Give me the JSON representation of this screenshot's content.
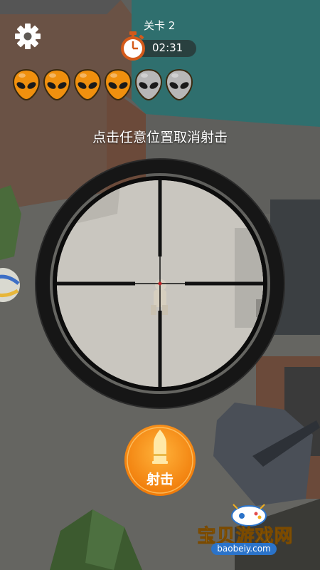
{
  "hud": {
    "level_label": "关卡 2",
    "timer": "02:31",
    "hint": "点击任意位置取消射击",
    "fire_label": "射击"
  },
  "targets": {
    "total": 6,
    "remaining": 4,
    "icon": "alien-head-icon",
    "active_color": "#f0900e",
    "inactive_color": "#b7b7b7"
  },
  "icons": {
    "settings": "gear-icon",
    "timer": "stopwatch-icon",
    "fire": "bullet-icon"
  },
  "watermark": {
    "title": "宝贝游戏网",
    "url": "baobeiy.com"
  }
}
